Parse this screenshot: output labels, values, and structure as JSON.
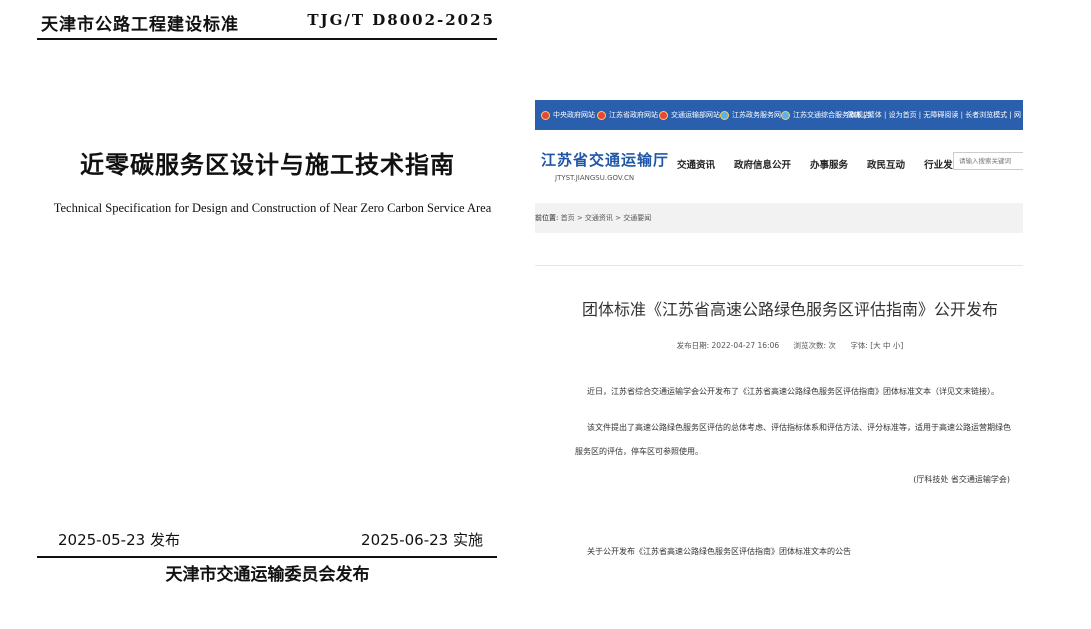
{
  "document": {
    "issuer": "天津市公路工程建设标准",
    "code": "TJG/T D8002-2025",
    "title_cn": "近零碳服务区设计与施工技术指南",
    "title_en": "Technical Specification for Design and Construction of Near Zero Carbon Service Area",
    "publish_date": "2025-05-23 发布",
    "effective_date": "2025-06-23 实施",
    "publisher": "天津市交通运输委员会发布"
  },
  "website": {
    "topbar": {
      "links": [
        {
          "label": "中央政府网站",
          "icon": "emblem-icon"
        },
        {
          "label": "江苏省政府网站",
          "icon": "emblem-icon"
        },
        {
          "label": "交通运输部网站",
          "icon": "emblem-icon"
        },
        {
          "label": "江苏政务服务网",
          "icon": "service-icon"
        },
        {
          "label": "江苏交通综合服务旗舰店",
          "icon": "service-icon"
        }
      ],
      "utility": "简体 | 繁体 | 设为首页 | 无障碍阅读 | 长者浏览模式 | 网"
    },
    "logo": {
      "name": "江苏省交通运输厅",
      "domain": "JTYST.JIANGSU.GOV.CN"
    },
    "nav": [
      "交通资讯",
      "政府信息公开",
      "办事服务",
      "政民互动",
      "行业发展"
    ],
    "search": {
      "placeholder": "请输入搜索关键词"
    },
    "breadcrumb": {
      "lead": "前位置:",
      "path": "首页 > 交通资讯 > 交通要闻"
    },
    "article": {
      "title": "团体标准《江苏省高速公路绿色服务区评估指南》公开发布",
      "date": "发布日期: 2022-04-27 16:06",
      "views": "浏览次数: 次",
      "font_size": "字体: [大 中 小]",
      "paragraph1": "近日，江苏省综合交通运输学会公开发布了《江苏省高速公路绿色服务区评估指南》团体标准文本（详见文末链接）。",
      "paragraph2": "该文件提出了高速公路绿色服务区评估的总体考虑、评估指标体系和评估方法、评分标准等，适用于高速公路运营期绿色服务区的评估，停车区可参照使用。",
      "signature": "(厅科技处 省交通运输学会)",
      "attachment": "关于公开发布《江苏省高速公路绿色服务区评估指南》团体标准文本的公告"
    }
  }
}
